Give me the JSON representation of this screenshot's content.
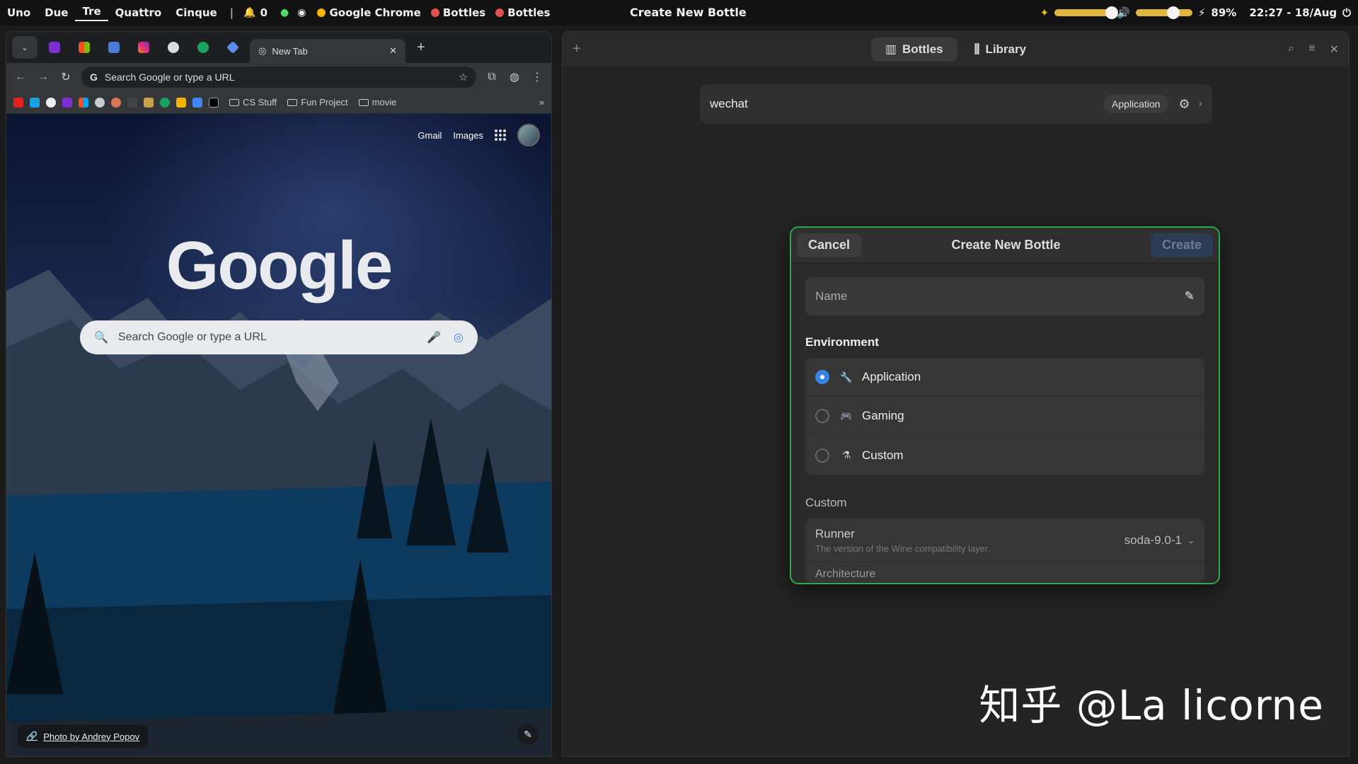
{
  "topbar": {
    "workspaces": [
      "Uno",
      "Due",
      "Tre",
      "Quattro",
      "Cinque"
    ],
    "active_workspace": "Tre",
    "separator": "|",
    "notif_count": "0",
    "apps": [
      {
        "label": "Google Chrome",
        "color": "#f4b400"
      },
      {
        "label": "Bottles",
        "color": "#e0524f"
      },
      {
        "label": "Bottles",
        "color": "#e0524f"
      }
    ],
    "window_title": "Create New Bottle",
    "battery": "89%",
    "clock": "22:27 - 18/Aug"
  },
  "chrome": {
    "tab_title": "New Tab",
    "omnibox_placeholder": "Search Google or type a URL",
    "bookmark_folders": [
      "CS Stuff",
      "Fun Project",
      "movie"
    ],
    "links": {
      "gmail": "Gmail",
      "images": "Images"
    },
    "logo": "Google",
    "search_placeholder": "Search Google or type a URL",
    "photo_credit": "Photo by Andrey Popov"
  },
  "bottles": {
    "views": [
      {
        "label": "Bottles",
        "active": true
      },
      {
        "label": "Library",
        "active": false
      }
    ],
    "bottle": {
      "name": "wechat",
      "tag": "Application"
    },
    "dialog": {
      "cancel": "Cancel",
      "title": "Create New Bottle",
      "create": "Create",
      "name_label": "Name",
      "environment_title": "Environment",
      "environments": [
        {
          "label": "Application",
          "icon": "wrench-icon",
          "selected": true
        },
        {
          "label": "Gaming",
          "icon": "gamepad-icon",
          "selected": false
        },
        {
          "label": "Custom",
          "icon": "flask-icon",
          "selected": false
        }
      ],
      "custom_title": "Custom",
      "runner_label": "Runner",
      "runner_desc": "The version of the Wine compatibility layer.",
      "runner_value": "soda-9.0-1",
      "architecture_label": "Architecture"
    }
  },
  "watermark": "知乎 @La licorne"
}
